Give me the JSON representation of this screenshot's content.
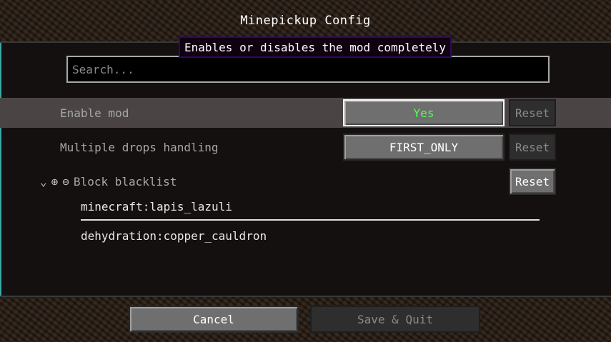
{
  "title": "Minepickup Config",
  "search": {
    "placeholder": "Search..."
  },
  "tooltip": "Enables or disables the mod completely",
  "options": [
    {
      "label": "Enable mod",
      "value": "Yes",
      "reset": "Reset"
    },
    {
      "label": "Multiple drops handling",
      "value": "FIRST_ONLY",
      "reset": "Reset"
    }
  ],
  "category": {
    "label": "Block blacklist",
    "reset": "Reset",
    "icons": [
      "chevron-down-icon",
      "add-icon",
      "remove-icon"
    ],
    "entries": [
      "minecraft:lapis_lazuli",
      "dehydration:copper_cauldron"
    ]
  },
  "footer": {
    "cancel": "Cancel",
    "save": "Save & Quit"
  },
  "colors": {
    "value_on": "#55ff55",
    "tooltip_border": "#2b0a5e",
    "scroll_accent": "#3aa8a8"
  }
}
